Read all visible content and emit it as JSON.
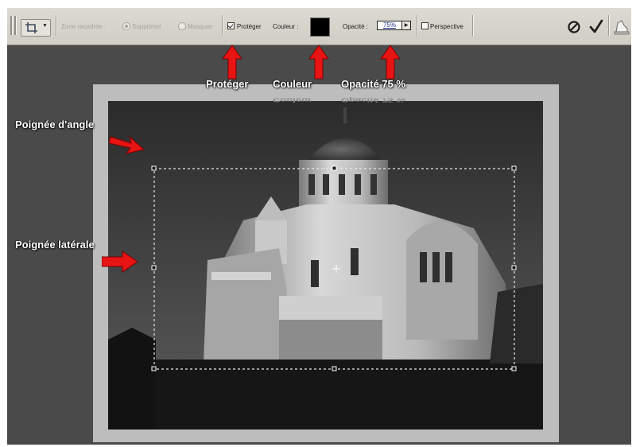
{
  "options_bar": {
    "crop_area_label": "Zone recadrée :",
    "delete_label": "Supprimer",
    "hide_label": "Masquer",
    "shield_label": "Protéger",
    "color_label": "Couleur :",
    "opacity_label": "Opacité :",
    "opacity_value": "75%",
    "perspective_label": "Perspective",
    "shield_checked": true,
    "perspective_checked": false,
    "shield_color": "#000000",
    "cancel_icon": "cancel-icon",
    "commit_icon": "checkmark-icon",
    "palette_icon": "palette-well-icon"
  },
  "annotations": {
    "shield": "Protéger",
    "color": "Couleur",
    "opacity": "Opacité 75 %",
    "corner_handle": "Poignée d'angle",
    "side_handle": "Poignée latérale"
  },
  "colors": {
    "workspace": "#4a4a4a",
    "canvas_border": "#bdbdbd",
    "arrow": "#e81414"
  }
}
